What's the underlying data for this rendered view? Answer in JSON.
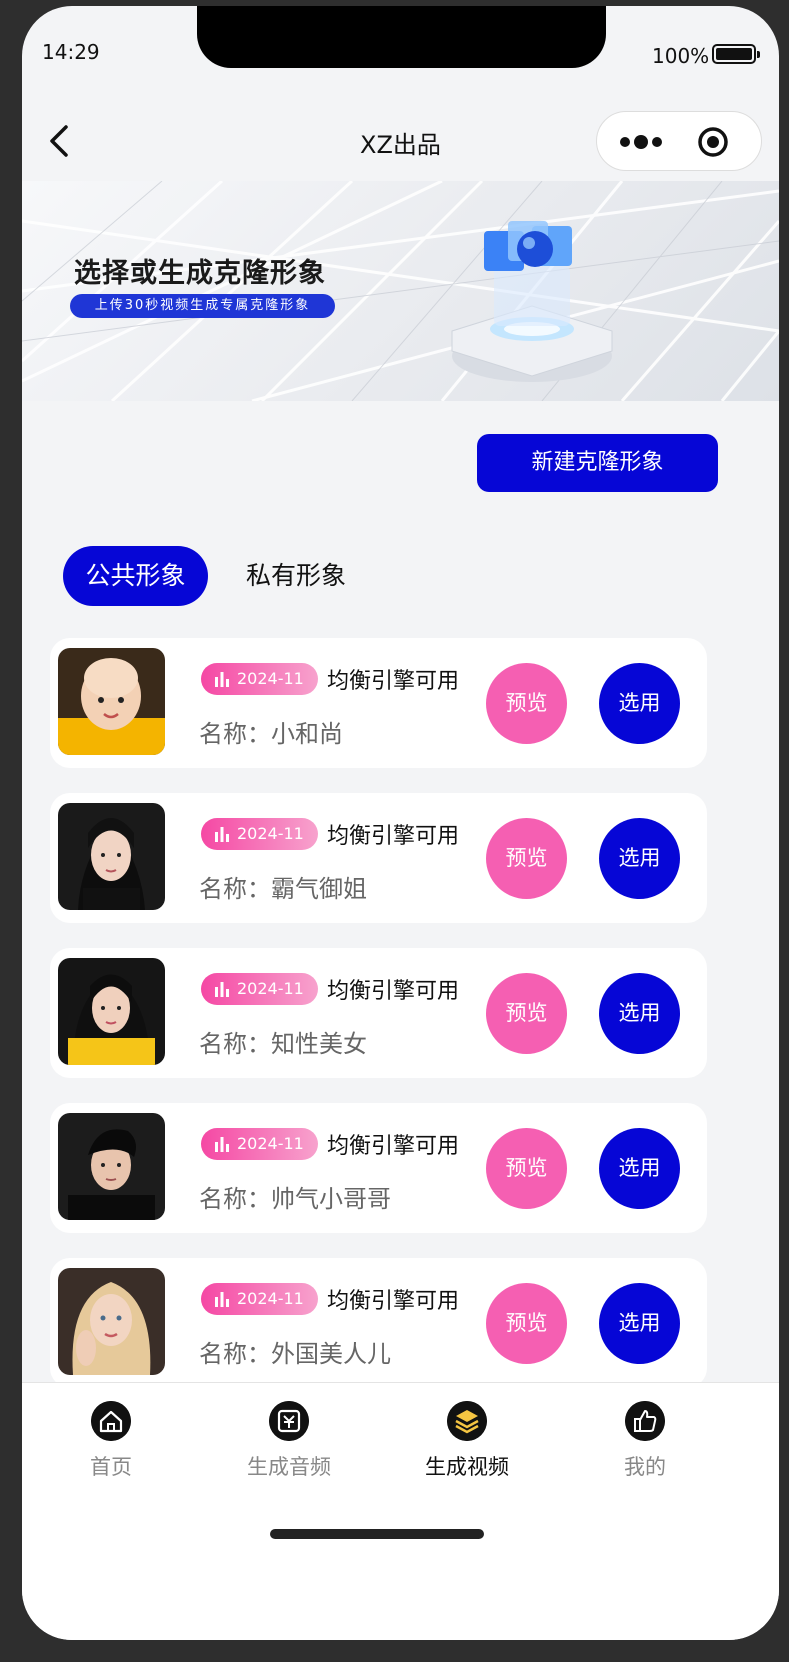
{
  "status": {
    "time": "14:29",
    "battery": "100%"
  },
  "nav": {
    "title": "XZ出品"
  },
  "banner": {
    "title": "选择或生成克隆形象",
    "subtitle": "上传30秒视频生成专属克隆形象"
  },
  "actions": {
    "new_clone": "新建克隆形象"
  },
  "tabs": [
    {
      "label": "公共形象",
      "active": true
    },
    {
      "label": "私有形象",
      "active": false
    }
  ],
  "list": [
    {
      "date": "2024-11",
      "engine": "均衡引擎可用",
      "name_label": "名称：",
      "name": "小和尚",
      "preview": "预览",
      "select": "选用"
    },
    {
      "date": "2024-11",
      "engine": "均衡引擎可用",
      "name_label": "名称：",
      "name": "霸气御姐",
      "preview": "预览",
      "select": "选用"
    },
    {
      "date": "2024-11",
      "engine": "均衡引擎可用",
      "name_label": "名称：",
      "name": "知性美女",
      "preview": "预览",
      "select": "选用"
    },
    {
      "date": "2024-11",
      "engine": "均衡引擎可用",
      "name_label": "名称：",
      "name": "帅气小哥哥",
      "preview": "预览",
      "select": "选用"
    },
    {
      "date": "2024-11",
      "engine": "均衡引擎可用",
      "name_label": "名称：",
      "name": "外国美人儿",
      "preview": "预览",
      "select": "选用"
    }
  ],
  "tabbar": [
    {
      "label": "首页",
      "icon": "home-icon",
      "active": false
    },
    {
      "label": "生成音频",
      "icon": "audio-icon",
      "active": false
    },
    {
      "label": "生成视频",
      "icon": "layers-icon",
      "active": true
    },
    {
      "label": "我的",
      "icon": "thumbs-up-icon",
      "active": false
    }
  ],
  "colors": {
    "primary": "#0606d6",
    "preview": "#f55fb2",
    "badge": "#f548a4",
    "background": "#f3f4f6"
  }
}
